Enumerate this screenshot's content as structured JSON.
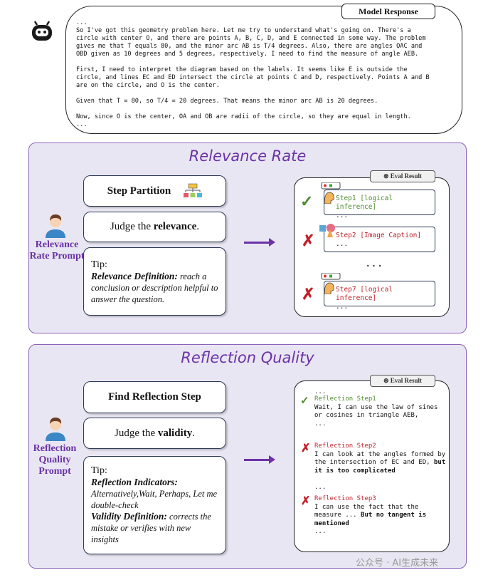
{
  "model_response": {
    "tag": "Model Response",
    "text": "...\nSo I've got this geometry problem here. Let me try to understand what's going on. There's a\ncircle with center O, and there are points A, B, C, D, and E connected in some way. The problem\ngives me that T equals 80, and the minor arc AB is T/4 degrees. Also, there are angles OAC and\nOBD given as 10 degrees and 5 degrees, respectively. I need to find the measure of angle AEB.\n\nFirst, I need to interpret the diagram based on the labels. It seems like E is outside the\ncircle, and lines EC and ED intersect the circle at points C and D, respectively. Points A and B\nare on the circle, and O is the center.\n\nGiven that T = 80, so T/4 = 20 degrees. That means the minor arc AB is 20 degrees.\n\nNow, since O is the center, OA and OB are radii of the circle, so they are equal in length.\n..."
  },
  "relevance": {
    "title": "Relevance Rate",
    "prompt_label": "Relevance Rate Prompt",
    "step_partition": "Step Partition",
    "judge_prefix": "Judge the ",
    "judge_bold": "relevance",
    "judge_suffix": ".",
    "tip": "Tip:",
    "def_title": "Relevance Definition:",
    "def_text": " reach a conclusion or description helpful to answer the question.",
    "eval_tag": "Eval Result",
    "steps": [
      {
        "label": "Step1 [logical inference]",
        "body": "...",
        "verdict": "correct"
      },
      {
        "label": "Step2 [Image Caption]",
        "body": "...",
        "verdict": "wrong"
      },
      {
        "label": "Step7 [logical inference]",
        "body": "...",
        "verdict": "wrong"
      }
    ],
    "ellipsis": "..."
  },
  "reflection": {
    "title": "Reflection Quality",
    "prompt_label": "Reflection Quality Prompt",
    "find_step": "Find Reflection Step",
    "judge_prefix": "Judge the ",
    "judge_bold": "validity",
    "judge_suffix": ".",
    "tip": "Tip:",
    "ind_title": "Reflection Indicators:",
    "ind_text": "Alternatively,Wait, Perhaps, Let me double-check",
    "val_title": "Validity Definition:",
    "val_text": " corrects the mistake or verifies with new insights",
    "eval_tag": "Eval Result",
    "lead": "...",
    "steps": [
      {
        "label": "Reflection Step1",
        "text": "Wait, I can use the law of sines or cosines in triangle AEB,",
        "bold": "",
        "tail": "...",
        "verdict": "correct"
      },
      {
        "label": "Reflection Step2",
        "text": "I can look at the angles formed by the intersection of EC and ED, ",
        "bold": "but it is too complicated",
        "tail": "...",
        "verdict": "wrong"
      },
      {
        "label": "Reflection Step3",
        "text": "I can use the fact that the measure ... ",
        "bold": "But no tangent is mentioned",
        "tail": "...",
        "verdict": "wrong"
      }
    ]
  },
  "watermark": "公众号 · AI生成未来",
  "colors": {
    "accent": "#6a33a6",
    "correct": "#4e8a2d",
    "wrong": "#c3202a",
    "panel_bg": "#e9e6f3"
  },
  "icons": {
    "bot": "robot-icon",
    "user": "person-icon",
    "check": "check-icon",
    "cross": "cross-icon",
    "openai": "openai-icon",
    "flowchart": "flowchart-icon"
  }
}
